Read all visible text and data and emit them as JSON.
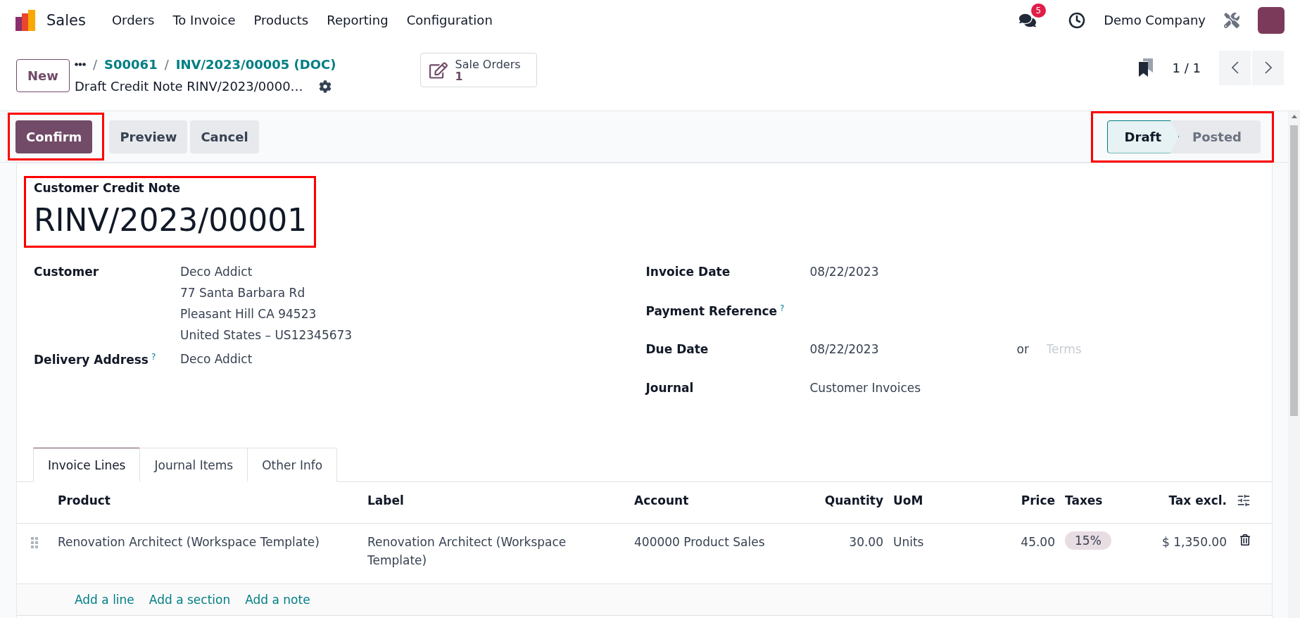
{
  "navbar": {
    "app_name": "Sales",
    "menu": [
      "Orders",
      "To Invoice",
      "Products",
      "Reporting",
      "Configuration"
    ],
    "messages_badge": "5",
    "company": "Demo Company"
  },
  "control_panel": {
    "new_button": "New",
    "separator": "/",
    "breadcrumbs": [
      "S00061",
      "INV/2023/00005 (DOC)"
    ],
    "record_title": "Draft Credit Note RINV/2023/0000…",
    "smart_button": {
      "label": "Sale Orders",
      "count": "1"
    },
    "pager": "1 / 1"
  },
  "action_buttons": [
    {
      "label": "Confirm",
      "primary": true,
      "highlighted": true
    },
    {
      "label": "Preview",
      "primary": false,
      "highlighted": false
    },
    {
      "label": "Cancel",
      "primary": false,
      "highlighted": false
    }
  ],
  "status_bar": {
    "highlighted": true,
    "stages": [
      {
        "label": "Draft",
        "selected": true
      },
      {
        "label": "Posted",
        "selected": false
      }
    ]
  },
  "record": {
    "highlighted": true,
    "type_label": "Customer Credit Note",
    "number": "RINV/2023/00001"
  },
  "left_fields": [
    {
      "label": "Customer",
      "lines": [
        "Deco Addict",
        "77 Santa Barbara Rd",
        "Pleasant Hill CA 94523",
        "United States – US12345673"
      ]
    },
    {
      "label": "Delivery Address",
      "help": "?",
      "lines": [
        "Deco Addict"
      ]
    }
  ],
  "right_fields": [
    {
      "label": "Invoice Date",
      "value": "08/22/2023"
    },
    {
      "label": "Payment Reference",
      "help": "?"
    },
    {
      "label": "Due Date",
      "value": "08/22/2023",
      "or_text": "or",
      "terms_placeholder": "Terms"
    },
    {
      "label": "Journal",
      "value": "Customer Invoices"
    }
  ],
  "notebook": {
    "tabs": [
      {
        "label": "Invoice Lines",
        "selected": true
      },
      {
        "label": "Journal Items",
        "selected": false
      },
      {
        "label": "Other Info",
        "selected": false
      }
    ],
    "columns": [
      {
        "label": "Product",
        "kind": "text"
      },
      {
        "label": "Label",
        "kind": "text"
      },
      {
        "label": "Account",
        "kind": "text"
      },
      {
        "label": "Quantity",
        "kind": "number"
      },
      {
        "label": "UoM",
        "kind": "text"
      },
      {
        "label": "Price",
        "kind": "number"
      },
      {
        "label": "Taxes",
        "kind": "tags"
      },
      {
        "label": "Tax excl.",
        "kind": "number"
      }
    ],
    "rows": [
      {
        "product": "Renovation Architect (Workspace Template)",
        "label": "Renovation Architect (Workspace Template)",
        "account": "400000 Product Sales",
        "quantity": "30.00",
        "uom": "Units",
        "price": "45.00",
        "taxes": [
          "15%"
        ],
        "tax_excl": "$ 1,350.00"
      }
    ],
    "add_links": [
      "Add a line",
      "Add a section",
      "Add a note"
    ]
  }
}
